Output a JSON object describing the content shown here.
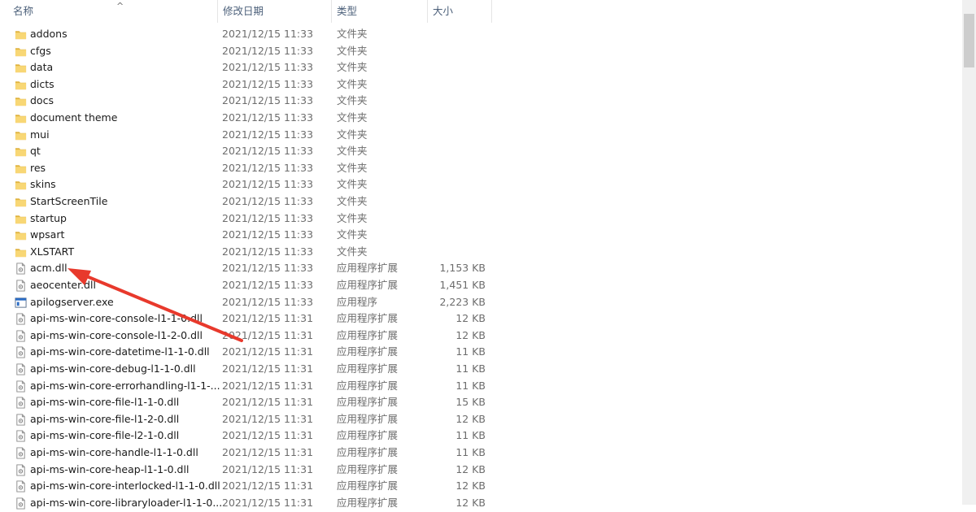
{
  "header": {
    "name": "名称",
    "date": "修改日期",
    "type": "类型",
    "size": "大小"
  },
  "files": [
    {
      "icon": "folder-icon",
      "name": "addons",
      "date": "2021/12/15 11:33",
      "type": "文件夹",
      "size": ""
    },
    {
      "icon": "folder-icon",
      "name": "cfgs",
      "date": "2021/12/15 11:33",
      "type": "文件夹",
      "size": ""
    },
    {
      "icon": "folder-icon",
      "name": "data",
      "date": "2021/12/15 11:33",
      "type": "文件夹",
      "size": ""
    },
    {
      "icon": "folder-icon",
      "name": "dicts",
      "date": "2021/12/15 11:33",
      "type": "文件夹",
      "size": ""
    },
    {
      "icon": "folder-icon",
      "name": "docs",
      "date": "2021/12/15 11:33",
      "type": "文件夹",
      "size": ""
    },
    {
      "icon": "folder-icon",
      "name": "document theme",
      "date": "2021/12/15 11:33",
      "type": "文件夹",
      "size": ""
    },
    {
      "icon": "folder-icon",
      "name": "mui",
      "date": "2021/12/15 11:33",
      "type": "文件夹",
      "size": ""
    },
    {
      "icon": "folder-icon",
      "name": "qt",
      "date": "2021/12/15 11:33",
      "type": "文件夹",
      "size": ""
    },
    {
      "icon": "folder-icon",
      "name": "res",
      "date": "2021/12/15 11:33",
      "type": "文件夹",
      "size": ""
    },
    {
      "icon": "folder-icon",
      "name": "skins",
      "date": "2021/12/15 11:33",
      "type": "文件夹",
      "size": ""
    },
    {
      "icon": "folder-icon",
      "name": "StartScreenTile",
      "date": "2021/12/15 11:33",
      "type": "文件夹",
      "size": ""
    },
    {
      "icon": "folder-icon",
      "name": "startup",
      "date": "2021/12/15 11:33",
      "type": "文件夹",
      "size": ""
    },
    {
      "icon": "folder-icon",
      "name": "wpsart",
      "date": "2021/12/15 11:33",
      "type": "文件夹",
      "size": ""
    },
    {
      "icon": "folder-icon",
      "name": "XLSTART",
      "date": "2021/12/15 11:33",
      "type": "文件夹",
      "size": ""
    },
    {
      "icon": "dll-file-icon",
      "name": "acm.dll",
      "date": "2021/12/15 11:33",
      "type": "应用程序扩展",
      "size": "1,153 KB"
    },
    {
      "icon": "dll-file-icon",
      "name": "aeocenter.dll",
      "date": "2021/12/15 11:33",
      "type": "应用程序扩展",
      "size": "1,451 KB"
    },
    {
      "icon": "exe-file-icon",
      "name": "apilogserver.exe",
      "date": "2021/12/15 11:33",
      "type": "应用程序",
      "size": "2,223 KB"
    },
    {
      "icon": "dll-file-icon",
      "name": "api-ms-win-core-console-l1-1-0.dll",
      "date": "2021/12/15 11:31",
      "type": "应用程序扩展",
      "size": "12 KB"
    },
    {
      "icon": "dll-file-icon",
      "name": "api-ms-win-core-console-l1-2-0.dll",
      "date": "2021/12/15 11:31",
      "type": "应用程序扩展",
      "size": "12 KB"
    },
    {
      "icon": "dll-file-icon",
      "name": "api-ms-win-core-datetime-l1-1-0.dll",
      "date": "2021/12/15 11:31",
      "type": "应用程序扩展",
      "size": "11 KB"
    },
    {
      "icon": "dll-file-icon",
      "name": "api-ms-win-core-debug-l1-1-0.dll",
      "date": "2021/12/15 11:31",
      "type": "应用程序扩展",
      "size": "11 KB"
    },
    {
      "icon": "dll-file-icon",
      "name": "api-ms-win-core-errorhandling-l1-1-...",
      "date": "2021/12/15 11:31",
      "type": "应用程序扩展",
      "size": "11 KB"
    },
    {
      "icon": "dll-file-icon",
      "name": "api-ms-win-core-file-l1-1-0.dll",
      "date": "2021/12/15 11:31",
      "type": "应用程序扩展",
      "size": "15 KB"
    },
    {
      "icon": "dll-file-icon",
      "name": "api-ms-win-core-file-l1-2-0.dll",
      "date": "2021/12/15 11:31",
      "type": "应用程序扩展",
      "size": "12 KB"
    },
    {
      "icon": "dll-file-icon",
      "name": "api-ms-win-core-file-l2-1-0.dll",
      "date": "2021/12/15 11:31",
      "type": "应用程序扩展",
      "size": "11 KB"
    },
    {
      "icon": "dll-file-icon",
      "name": "api-ms-win-core-handle-l1-1-0.dll",
      "date": "2021/12/15 11:31",
      "type": "应用程序扩展",
      "size": "11 KB"
    },
    {
      "icon": "dll-file-icon",
      "name": "api-ms-win-core-heap-l1-1-0.dll",
      "date": "2021/12/15 11:31",
      "type": "应用程序扩展",
      "size": "12 KB"
    },
    {
      "icon": "dll-file-icon",
      "name": "api-ms-win-core-interlocked-l1-1-0.dll",
      "date": "2021/12/15 11:31",
      "type": "应用程序扩展",
      "size": "12 KB"
    },
    {
      "icon": "dll-file-icon",
      "name": "api-ms-win-core-libraryloader-l1-1-0...",
      "date": "2021/12/15 11:31",
      "type": "应用程序扩展",
      "size": "12 KB"
    }
  ],
  "colors": {
    "folder": "#f8d775",
    "folder_dark": "#e0b440",
    "annotation_arrow": "#e8392c",
    "header_text": "#4c607a"
  }
}
